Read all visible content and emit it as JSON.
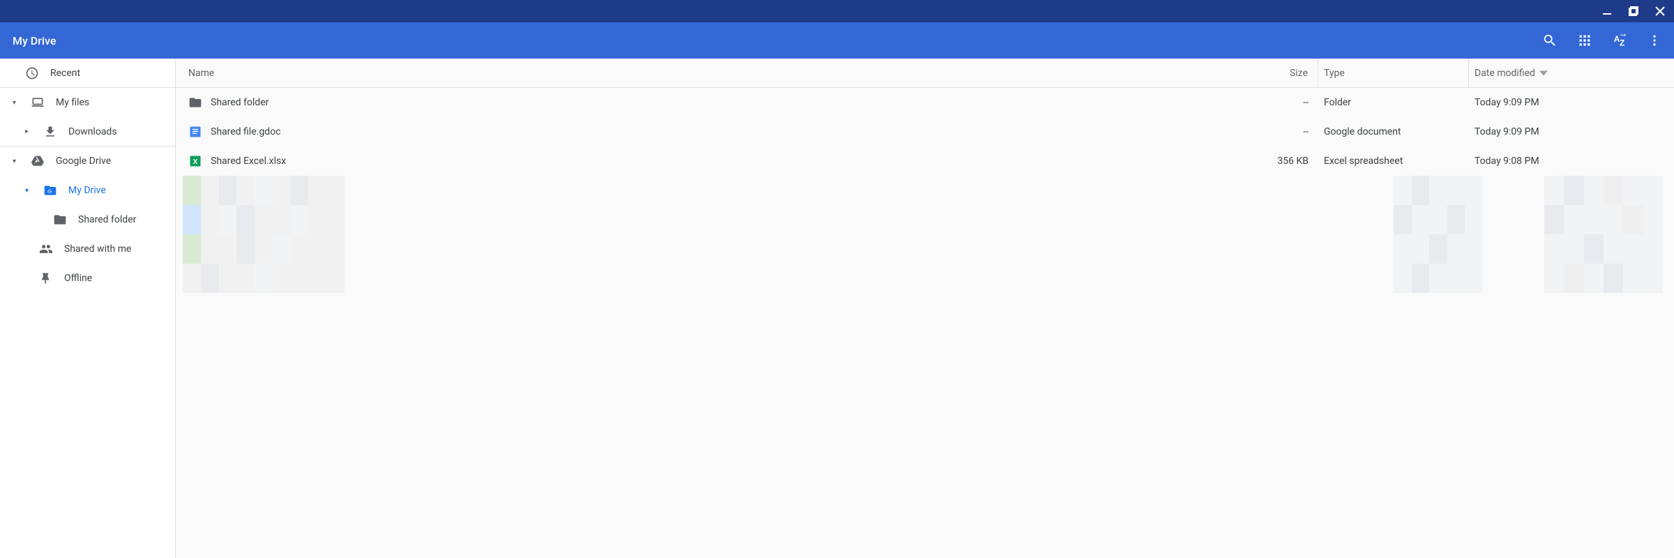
{
  "header": {
    "title": "My Drive"
  },
  "sidebar": {
    "recent": "Recent",
    "my_files": "My files",
    "downloads": "Downloads",
    "google_drive": "Google Drive",
    "my_drive": "My Drive",
    "shared_folder": "Shared folder",
    "shared_with_me": "Shared with me",
    "offline": "Offline"
  },
  "columns": {
    "name": "Name",
    "size": "Size",
    "type": "Type",
    "date": "Date modified"
  },
  "rows": [
    {
      "icon": "folder",
      "name": "Shared folder",
      "size": "--",
      "type": "Folder",
      "date": "Today 9:09 PM"
    },
    {
      "icon": "gdoc",
      "name": "Shared file.gdoc",
      "size": "--",
      "type": "Google document",
      "date": "Today 9:09 PM"
    },
    {
      "icon": "xlsx",
      "name": "Shared Excel.xlsx",
      "size": "356 KB",
      "type": "Excel spreadsheet",
      "date": "Today 9:08 PM"
    }
  ]
}
